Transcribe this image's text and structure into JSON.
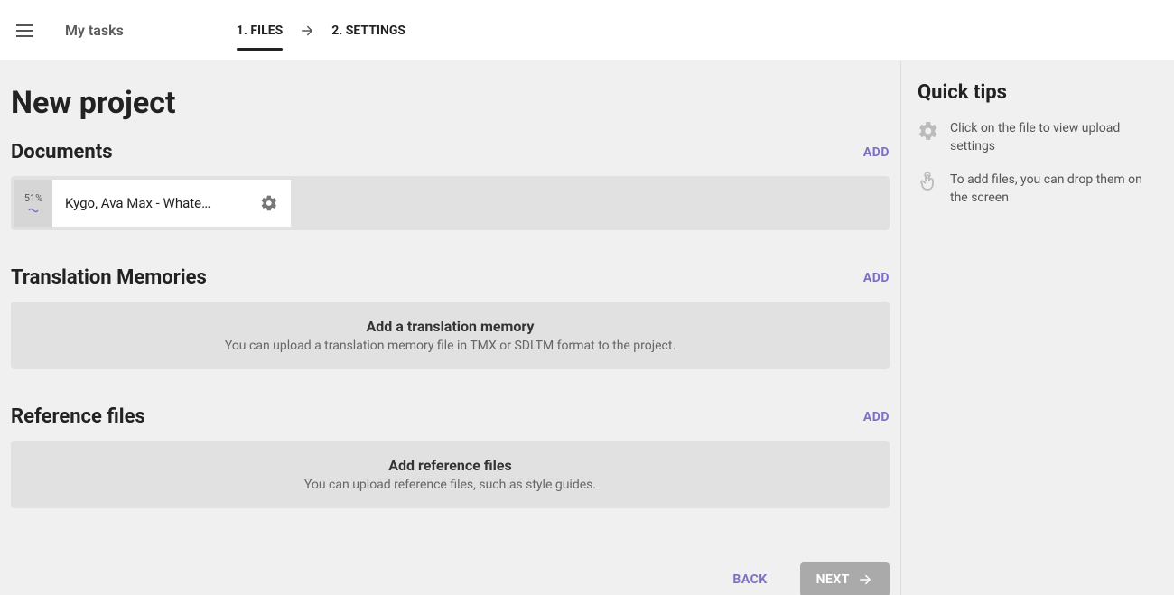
{
  "topbar": {
    "brand": "My tasks",
    "step1": "1. FILES",
    "step2": "2. SETTINGS"
  },
  "page": {
    "title": "New project"
  },
  "documents": {
    "title": "Documents",
    "add": "ADD",
    "items": [
      {
        "progress": "51%",
        "name": "Kygo, Ava Max - Whate…"
      }
    ]
  },
  "tm": {
    "title": "Translation Memories",
    "add": "ADD",
    "placeholder_title": "Add a translation memory",
    "placeholder_sub": "You can upload a translation memory file in TMX or SDLTM format to the project."
  },
  "ref": {
    "title": "Reference files",
    "add": "ADD",
    "placeholder_title": "Add reference files",
    "placeholder_sub": "You can upload reference files, such as style guides."
  },
  "buttons": {
    "back": "BACK",
    "next": "NEXT"
  },
  "tips": {
    "title": "Quick tips",
    "items": [
      "Click on the file to view upload settings",
      "To add files, you can drop them on the screen"
    ]
  }
}
